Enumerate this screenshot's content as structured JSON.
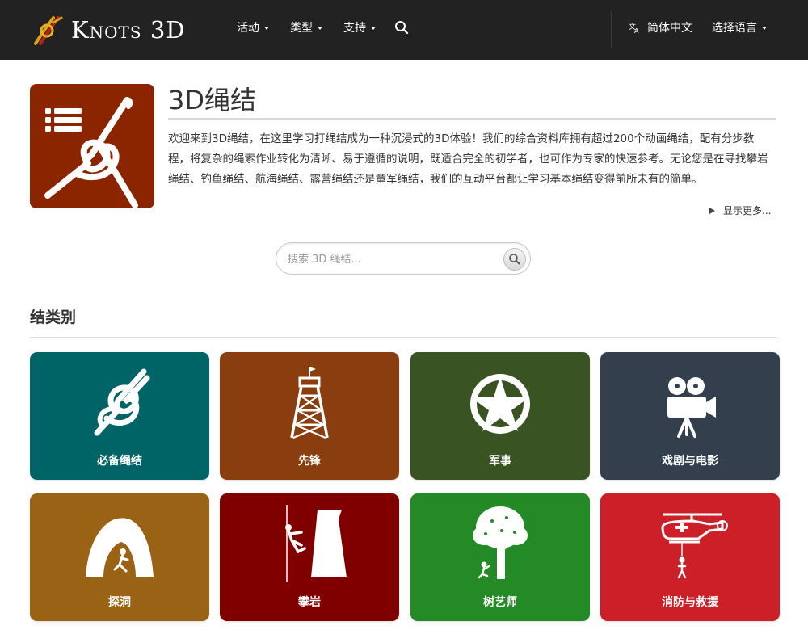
{
  "brand": {
    "name": "Knots 3D"
  },
  "nav": {
    "activities": "活动",
    "types": "类型",
    "support": "支持",
    "current_language": "简体中文",
    "select_language": "选择语言"
  },
  "hero": {
    "title": "3D绳结",
    "intro": "欢迎来到3D绳结，在这里学习打绳结成为一种沉浸式的3D体验！我们的综合资料库拥有超过200个动画绳结，配有分步教程，将复杂的绳索作业转化为清晰、易于遵循的说明，既适合完全的初学者，也可作为专家的快速参考。无论您是在寻找攀岩绳结、钓鱼绳结、航海绳结、露营绳结还是童军绳结，我们的互动平台都让学习基本绳结变得前所未有的简单。",
    "show_more": "显示更多..."
  },
  "search": {
    "placeholder": "搜索 3D 绳结..."
  },
  "section": {
    "title": "结类别"
  },
  "categories": [
    {
      "label": "必备绳结",
      "icon": "knot-icon",
      "color": "#006466"
    },
    {
      "label": "先锋",
      "icon": "tower-icon",
      "color": "#8a3e0f"
    },
    {
      "label": "军事",
      "icon": "star-icon",
      "color": "#3a5322"
    },
    {
      "label": "戏剧与电影",
      "icon": "film-camera-icon",
      "color": "#333f4d"
    },
    {
      "label": "探洞",
      "icon": "cave-icon",
      "color": "#9a6214"
    },
    {
      "label": "攀岩",
      "icon": "climber-icon",
      "color": "#800000"
    },
    {
      "label": "树艺师",
      "icon": "tree-icon",
      "color": "#248a25"
    },
    {
      "label": "消防与救援",
      "icon": "helicopter-icon",
      "color": "#cc1f28"
    }
  ]
}
